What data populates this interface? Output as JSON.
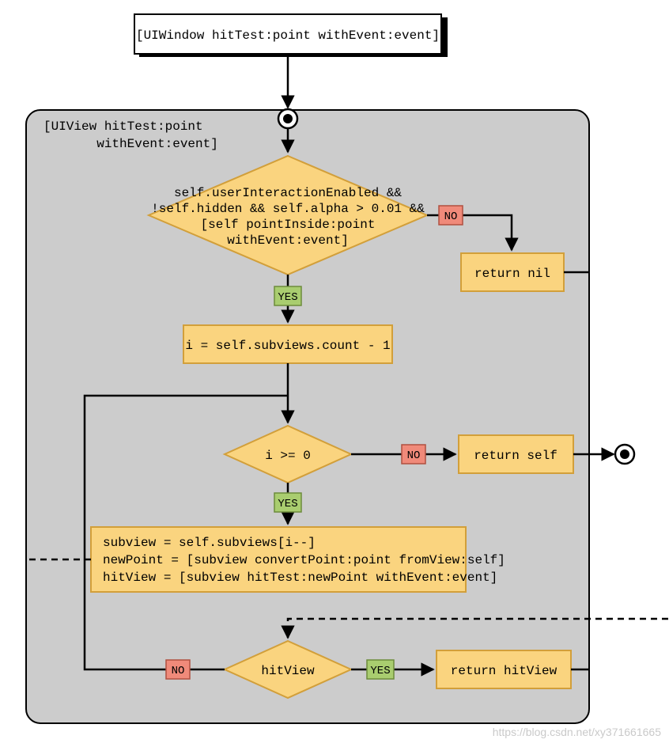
{
  "title_box": "[UIWindow hitTest:point withEvent:event]",
  "container_label_line1": "[UIView hitTest:point",
  "container_label_line2": "       withEvent:event]",
  "decision1_line1": "self.userInteractionEnabled &&",
  "decision1_line2": "!self.hidden && self.alpha > 0.01 &&",
  "decision1_line3": "[self pointInside:point",
  "decision1_line4": "withEvent:event]",
  "return_nil": "return nil",
  "init_i": "i = self.subviews.count - 1",
  "decision2": "i >= 0",
  "return_self": "return self",
  "loop_body_line1": "subview = self.subviews[i--]",
  "loop_body_line2": "newPoint = [subview convertPoint:point fromView:self]",
  "loop_body_line3": "hitView = [subview hitTest:newPoint withEvent:event]",
  "decision3": "hitView",
  "return_hitview": "return hitView",
  "yes": "YES",
  "no": "NO",
  "watermark": "https://blog.csdn.net/xy371661665"
}
